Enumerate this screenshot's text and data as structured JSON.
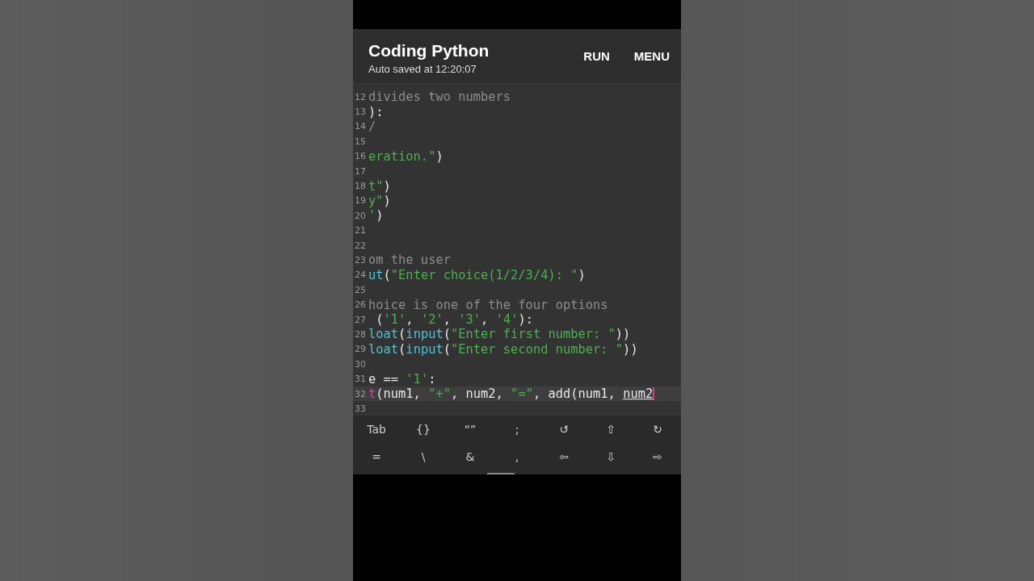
{
  "app_bar": {
    "title": "Coding Python",
    "subtitle": "Auto saved at 12:20:07",
    "actions": [
      "RUN",
      "MENU"
    ]
  },
  "editor": {
    "lines": [
      {
        "number": "12",
        "current": false,
        "tokens": [
          {
            "text": "divides two numbers",
            "kind": "comment"
          }
        ]
      },
      {
        "number": "13",
        "current": false,
        "tokens": [
          {
            "text": "):",
            "kind": "plain"
          }
        ]
      },
      {
        "number": "14",
        "current": false,
        "tokens": [
          {
            "text": "/",
            "kind": "comment"
          }
        ]
      },
      {
        "number": "15",
        "current": false
      },
      {
        "number": "16",
        "current": false,
        "tokens": [
          {
            "text": "eration.\"",
            "kind": "string"
          },
          {
            "text": ")",
            "kind": "plain"
          }
        ]
      },
      {
        "number": "17",
        "current": false
      },
      {
        "number": "18",
        "current": false,
        "tokens": [
          {
            "text": "t\"",
            "kind": "string"
          },
          {
            "text": ")",
            "kind": "plain"
          }
        ]
      },
      {
        "number": "19",
        "current": false,
        "tokens": [
          {
            "text": "y\"",
            "kind": "string"
          },
          {
            "text": ")",
            "kind": "plain"
          }
        ]
      },
      {
        "number": "20",
        "current": false,
        "tokens": [
          {
            "text": "'",
            "kind": "string"
          },
          {
            "text": ")",
            "kind": "plain"
          }
        ]
      },
      {
        "number": "21",
        "current": false
      },
      {
        "number": "22",
        "current": false
      },
      {
        "number": "23",
        "current": false,
        "tokens": [
          {
            "text": "om the user",
            "kind": "comment"
          }
        ]
      },
      {
        "number": "24",
        "current": false,
        "tokens": [
          {
            "text": "ut",
            "kind": "function"
          },
          {
            "text": "(",
            "kind": "plain"
          },
          {
            "text": "\"Enter choice(1/2/3/4): \"",
            "kind": "string"
          },
          {
            "text": ")",
            "kind": "plain"
          }
        ]
      },
      {
        "number": "25",
        "current": false
      },
      {
        "number": "26",
        "current": false,
        "tokens": [
          {
            "text": "hoice is one of the four options",
            "kind": "comment"
          }
        ]
      },
      {
        "number": "27",
        "current": false,
        "tokens": [
          {
            "text": " (",
            "kind": "plain"
          },
          {
            "text": "'1'",
            "kind": "string"
          },
          {
            "text": ", ",
            "kind": "plain"
          },
          {
            "text": "'2'",
            "kind": "string"
          },
          {
            "text": ", ",
            "kind": "plain"
          },
          {
            "text": "'3'",
            "kind": "string"
          },
          {
            "text": ", ",
            "kind": "plain"
          },
          {
            "text": "'4'",
            "kind": "string"
          },
          {
            "text": "):",
            "kind": "plain"
          }
        ]
      },
      {
        "number": "28",
        "current": false,
        "tokens": [
          {
            "text": "loat",
            "kind": "function"
          },
          {
            "text": "(",
            "kind": "plain"
          },
          {
            "text": "input",
            "kind": "function"
          },
          {
            "text": "(",
            "kind": "plain"
          },
          {
            "text": "\"Enter first number: \"",
            "kind": "string"
          },
          {
            "text": "))",
            "kind": "plain"
          }
        ]
      },
      {
        "number": "29",
        "current": false,
        "tokens": [
          {
            "text": "loat",
            "kind": "function"
          },
          {
            "text": "(",
            "kind": "plain"
          },
          {
            "text": "input",
            "kind": "function"
          },
          {
            "text": "(",
            "kind": "plain"
          },
          {
            "text": "\"Enter second number: \"",
            "kind": "string"
          },
          {
            "text": "))",
            "kind": "plain"
          }
        ]
      },
      {
        "number": "30",
        "current": false
      },
      {
        "number": "31",
        "current": false,
        "tokens": [
          {
            "text": "e == ",
            "kind": "plain"
          },
          {
            "text": "'1'",
            "kind": "string"
          },
          {
            "text": ":",
            "kind": "plain"
          }
        ]
      },
      {
        "number": "32",
        "current": true,
        "tokens": [
          {
            "text": "t",
            "kind": "keyword"
          },
          {
            "text": "(num1, ",
            "kind": "plain"
          },
          {
            "text": "\"+\"",
            "kind": "string"
          },
          {
            "text": ", num2, ",
            "kind": "plain"
          },
          {
            "text": "\"=\"",
            "kind": "string"
          },
          {
            "text": ", add(num1, ",
            "kind": "plain"
          },
          {
            "text": "num2",
            "kind": "underlined"
          }
        ]
      },
      {
        "number": "33",
        "current": false
      }
    ]
  },
  "key_bar": {
    "rows": [
      [
        "Tab",
        "{}",
        "“”",
        ";",
        "↺",
        "⇧",
        "↻"
      ],
      [
        "=",
        "\\",
        "&",
        ",",
        "⇦",
        "⇩",
        "⇨"
      ]
    ]
  }
}
